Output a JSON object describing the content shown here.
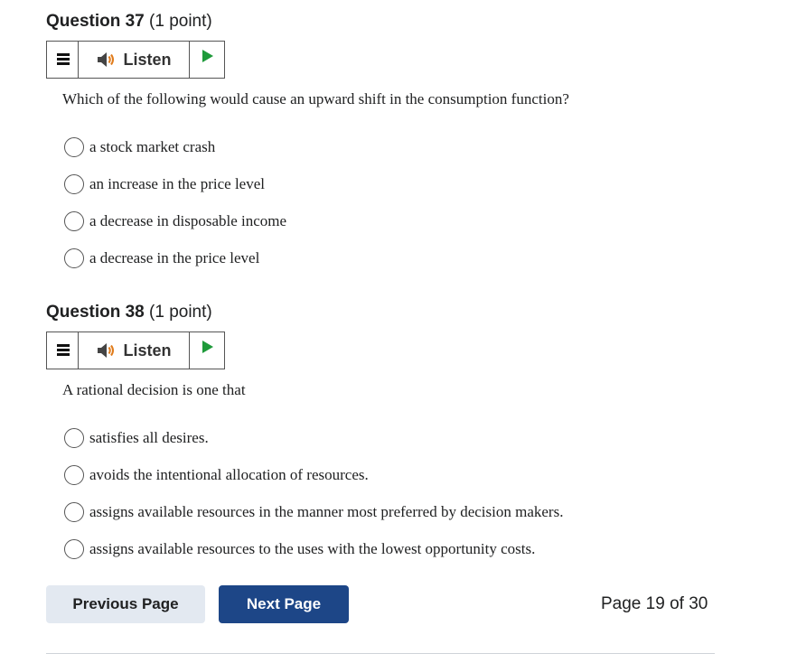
{
  "questions": [
    {
      "number_label": "Question 37",
      "points_label": "(1 point)",
      "listen_label": "Listen",
      "prompt": "Which of the following would cause an upward shift in the consumption function?",
      "options": [
        "a stock market crash",
        "an increase in the price level",
        "a decrease in disposable income",
        "a decrease in the price level"
      ]
    },
    {
      "number_label": "Question 38",
      "points_label": "(1 point)",
      "listen_label": "Listen",
      "prompt": "A rational decision is one that",
      "options": [
        "satisfies all desires.",
        "avoids the intentional allocation of resources.",
        "assigns available resources in the manner most preferred by decision makers.",
        "assigns available resources to the uses with the lowest opportunity costs."
      ]
    }
  ],
  "nav": {
    "previous_label": "Previous Page",
    "next_label": "Next Page",
    "page_info": "Page 19 of 30"
  },
  "colors": {
    "next_button_bg": "#1d4687",
    "previous_button_bg": "#e3e9f1",
    "speaker_icon": "#444444",
    "speaker_waves": "#e07b1a",
    "play_icon": "#1e9a3a"
  },
  "icons": {
    "menu": "menu-icon",
    "speaker": "speaker-icon",
    "play": "play-icon"
  }
}
